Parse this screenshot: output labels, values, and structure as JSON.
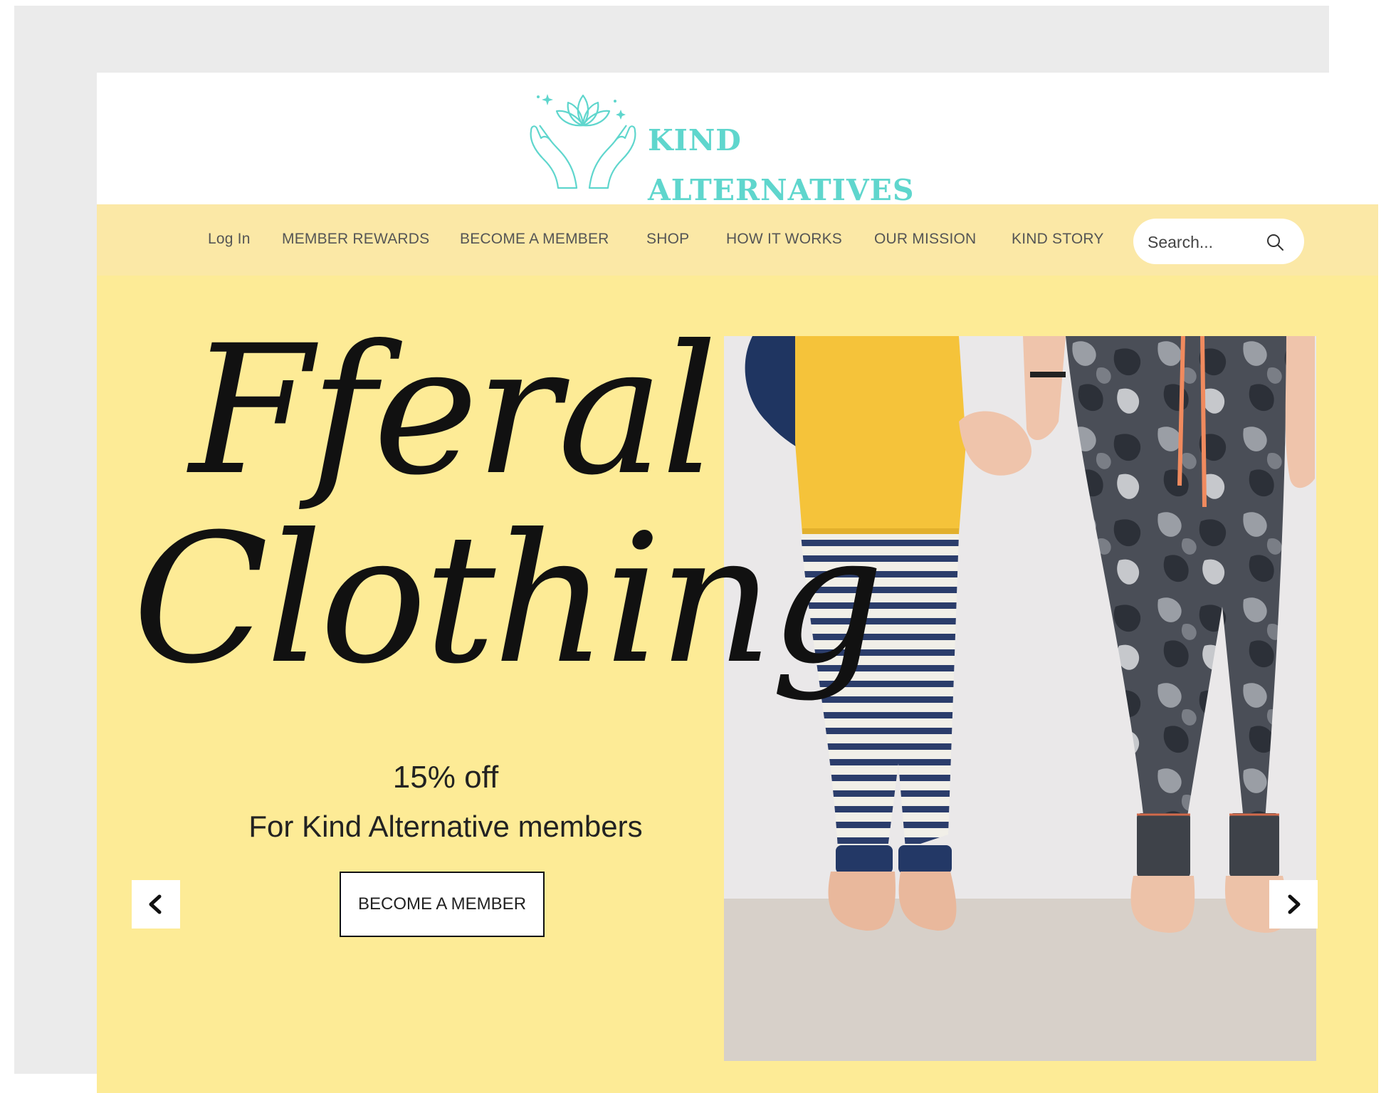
{
  "brand": {
    "line1": "KIND",
    "line2": "ALTERNATIVES",
    "color": "#5fd6cd"
  },
  "nav": {
    "items": [
      "Log In",
      "MEMBER REWARDS",
      "BECOME A MEMBER",
      "SHOP",
      "HOW IT WORKS",
      "OUR MISSION",
      "KIND STORY"
    ],
    "background": "#fbe8a6"
  },
  "search": {
    "placeholder": "Search..."
  },
  "hero": {
    "headline_line1": "Fferal",
    "headline_line2": "Clothing",
    "discount": "15% off",
    "subtext": "For Kind Alternative members",
    "cta_label": "BECOME A MEMBER",
    "background": "#fdeb96"
  },
  "icons": {
    "logo": "lotus-hands-icon",
    "search": "search-icon",
    "prev": "chevron-left-icon",
    "next": "chevron-right-icon"
  }
}
